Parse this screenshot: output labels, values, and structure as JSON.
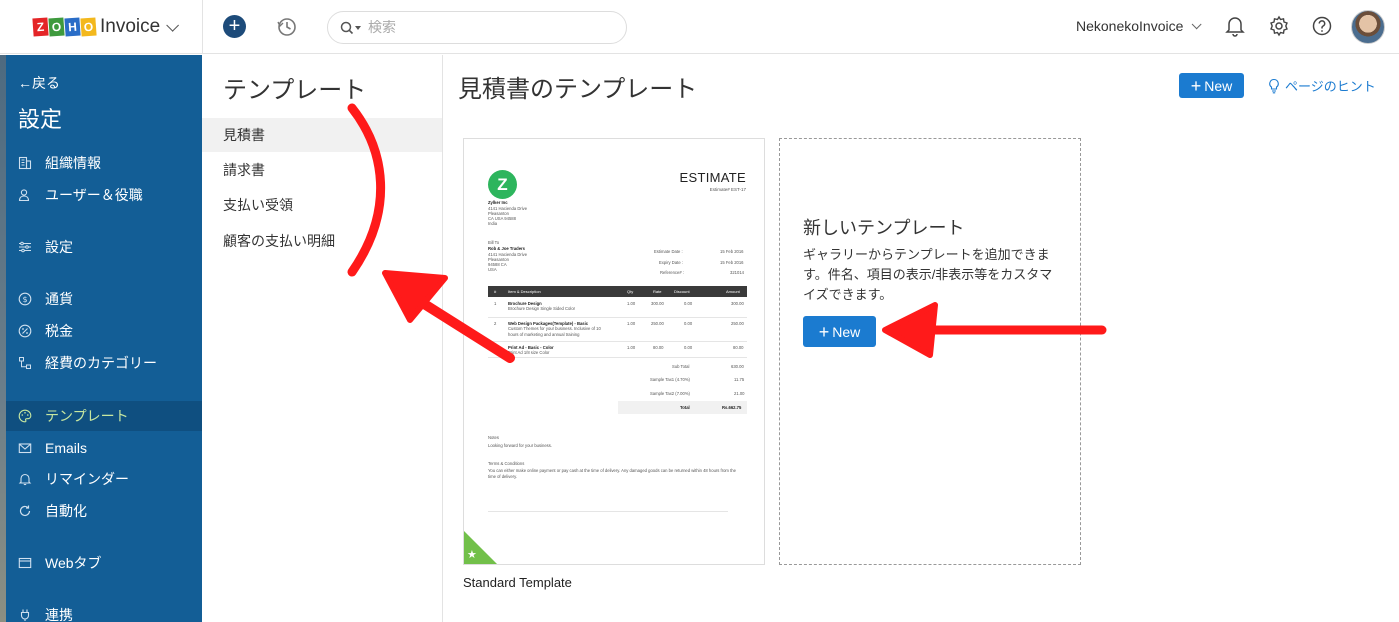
{
  "colors": {
    "sidebar_bg": "#135e96",
    "primary": "#1b7bd0",
    "active_text": "#c7e7a0",
    "annotation": "#ff0000"
  },
  "topbar": {
    "brand_letters": [
      "Z",
      "O",
      "H",
      "O"
    ],
    "brand_name": "Invoice",
    "search_placeholder": "検索",
    "org_name": "NekonekoInvoice"
  },
  "sidebar": {
    "back_label": "←戻る",
    "title": "設定",
    "items": [
      {
        "label": "組織情報",
        "icon": "building-icon"
      },
      {
        "label": "ユーザー＆役職",
        "icon": "users-icon"
      },
      {
        "label": "設定",
        "icon": "sliders-icon"
      },
      {
        "label": "通貨",
        "icon": "currency-icon"
      },
      {
        "label": "税金",
        "icon": "percent-icon"
      },
      {
        "label": "経費のカテゴリー",
        "icon": "category-tree-icon"
      },
      {
        "label": "テンプレート",
        "icon": "palette-icon",
        "active": true
      },
      {
        "label": "Emails",
        "icon": "mail-icon"
      },
      {
        "label": "リマインダー",
        "icon": "bell-icon"
      },
      {
        "label": "自動化",
        "icon": "refresh-icon"
      },
      {
        "label": "Webタブ",
        "icon": "window-icon"
      },
      {
        "label": "連携",
        "icon": "plug-icon"
      }
    ]
  },
  "subnav": {
    "title": "テンプレート",
    "items": [
      {
        "label": "見積書",
        "active": true
      },
      {
        "label": "請求書"
      },
      {
        "label": "支払い受領"
      },
      {
        "label": "顧客の支払い明細"
      }
    ]
  },
  "main": {
    "title": "見積書のテンプレート",
    "new_label": "New",
    "hint_label": "ページのヒント"
  },
  "template_card": {
    "name": "Standard Template",
    "preview": {
      "logo_letter": "Z",
      "heading": "ESTIMATE",
      "estimate_no": "Estimate# EST-17",
      "company": "Zylker Inc",
      "company_addr": [
        "4141 Hacienda Drive",
        "Pleasanton",
        "CA USA 94588",
        "India"
      ],
      "bill_to_label": "Bill To",
      "bill_to": [
        "Rob & Joe Traders",
        "4141 Hacienda Drive",
        "Pleasanton",
        "94588 CA",
        "USA"
      ],
      "meta": [
        {
          "k": "Estimate Date :",
          "v": "15 Feb 2016"
        },
        {
          "k": "Expiry Date :",
          "v": "15 Feb 2016"
        },
        {
          "k": "Reference# :",
          "v": "321014"
        }
      ],
      "columns": [
        "#",
        "Item & Description",
        "Qty",
        "Rate",
        "Discount",
        "Amount"
      ],
      "rows": [
        {
          "n": "1",
          "item": "Brochure Design",
          "desc": "Brochure Design Single Sided Color",
          "qty": "1.00",
          "rate": "300.00",
          "disc": "0.00",
          "amt": "300.00"
        },
        {
          "n": "2",
          "item": "Web Design Packages(Template) - Basic",
          "desc": "Custom Themes for your business. Inclusive of 10 hours of marketing and annual training",
          "qty": "1.00",
          "rate": "250.00",
          "disc": "0.00",
          "amt": "250.00"
        },
        {
          "n": "3",
          "item": "Print Ad - Basic - Color",
          "desc": "Print Ad 1/8 size Color",
          "qty": "1.00",
          "rate": "80.00",
          "disc": "0.00",
          "amt": "80.00"
        }
      ],
      "totals": [
        {
          "k": "Sub Total",
          "v": "630.00"
        },
        {
          "k": "Sample Tax1 (4.70%)",
          "v": "11.75"
        },
        {
          "k": "Sample Tax2 (7.00%)",
          "v": "21.00"
        },
        {
          "k": "Total",
          "v": "Rs.662.75"
        }
      ],
      "notes_label": "Notes",
      "notes": "Looking forward for your business.",
      "terms_label": "Terms & Conditions",
      "terms": "You can either make online payment or pay cash at the time of delivery. Any damaged goods can be returned within 48 hours from the time of delivery."
    }
  },
  "new_card": {
    "title": "新しいテンプレート",
    "description": "ギャラリーからテンプレートを追加できます。件名、項目の表示/非表示等をカスタマイズできます。",
    "button_label": "New"
  }
}
